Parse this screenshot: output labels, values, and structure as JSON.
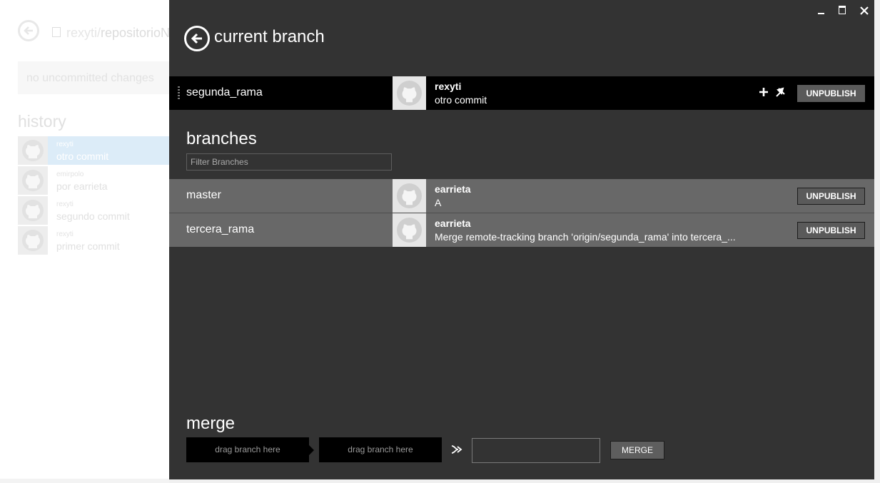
{
  "background_app": {
    "repo_owner": "rexyti/",
    "repo_name": "repositorioN",
    "changes_text": "no uncommitted changes",
    "history_title": "history",
    "history": [
      {
        "author": "rexyti",
        "message": "otro commit"
      },
      {
        "author": "emirpolo",
        "message": "por earrieta"
      },
      {
        "author": "rexyti",
        "message": "segundo commit"
      },
      {
        "author": "rexyti",
        "message": "primer commit"
      }
    ]
  },
  "page": {
    "title": "current branch"
  },
  "current_branch": {
    "name": "segunda_rama",
    "author": "rexyti",
    "message": "otro commit",
    "button": "UNPUBLISH"
  },
  "branches": {
    "title": "branches",
    "filter_placeholder": "Filter Branches",
    "items": [
      {
        "name": "master",
        "author": "earrieta",
        "message": "A",
        "button": "UNPUBLISH"
      },
      {
        "name": "tercera_rama",
        "author": "earrieta",
        "message": "Merge remote-tracking branch 'origin/segunda_rama' into tercera_...",
        "button": "UNPUBLISH"
      }
    ]
  },
  "merge": {
    "title": "merge",
    "drop1": "drag branch here",
    "drop2": "drag branch here",
    "button": "MERGE"
  },
  "colors": {
    "panel": "#333333",
    "current_row": "#000000",
    "branch_row": "#686868",
    "selected_history": "#dcecf8"
  }
}
